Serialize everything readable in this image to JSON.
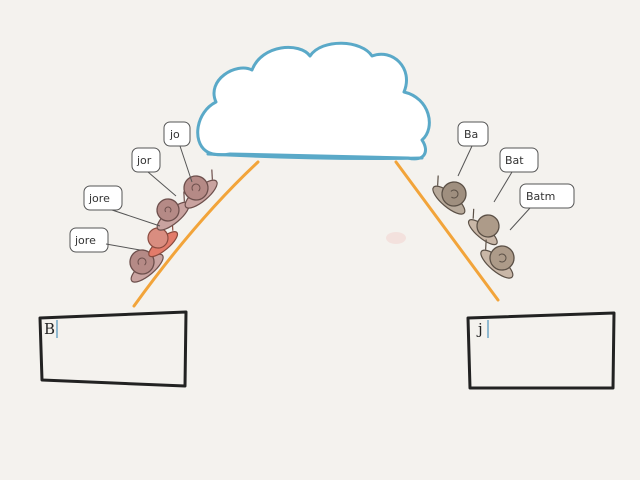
{
  "colors": {
    "cloud": "#5aa9c8",
    "arc": "#f2a43a",
    "snail_left": "#b58a86",
    "snail_right": "#9f8f7f",
    "box": "#222222",
    "cursor": "#6fa6c6",
    "bubble": "#555555"
  },
  "left_box": {
    "text": "B"
  },
  "right_box": {
    "text": "j"
  },
  "left_bubbles": [
    "jo",
    "jor",
    "jore",
    "jore"
  ],
  "right_bubbles": [
    "Ba",
    "Bat",
    "Batm"
  ]
}
